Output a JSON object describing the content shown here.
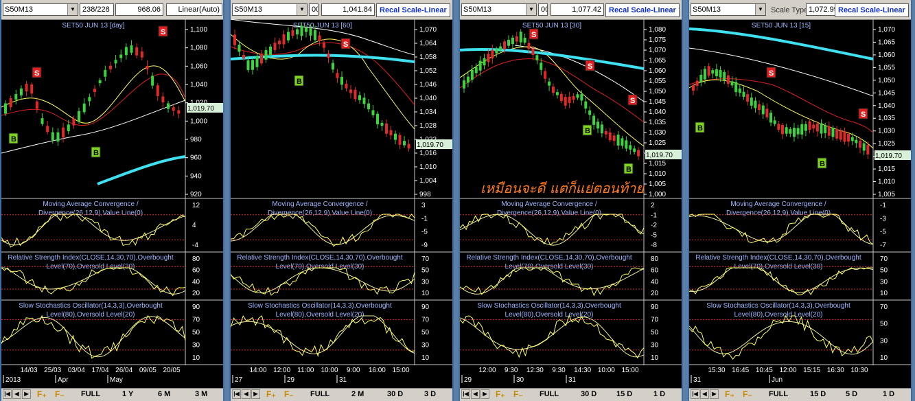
{
  "colors": {
    "candle_up": "#3cd43c",
    "candle_down": "#e02a2a",
    "ma_white": "#ffffff",
    "ma_yellow": "#ffff60",
    "ma_red": "#e02020",
    "ma_cyan": "#3fe0f0",
    "indicator_title": "#9fb8ff",
    "axis_text": "#ffffff",
    "signal_sell": "#e02020",
    "signal_buy": "#7ed321",
    "grid_red": "#d03030"
  },
  "annotation": {
    "text": "เหมือนจะดี แต่ก็แย่ตอนท้าย"
  },
  "panels": [
    {
      "id": "day",
      "symbol": "S50M13",
      "field2": "238/228",
      "field3": "968.06",
      "scale_label": "Linear(Auto)",
      "scale_is_button": false,
      "ghost_label": "",
      "title": "SET50 JUN 13   [day]",
      "price_labels": [
        "1,100",
        "1,080",
        "1,060",
        "1,040",
        "1,020",
        "1,000",
        "980",
        "960",
        "940",
        "920"
      ],
      "price_range": [
        912,
        1112
      ],
      "last_price": "1,019.70",
      "macd_title": [
        "Moving Average Convergence /",
        "Divergence(26,12,9),Value Line(0)"
      ],
      "macd_ticks": [
        "12",
        "4",
        "-4"
      ],
      "rsi_title": [
        "Relative Strength Index(CLOSE,14,30,70),Overbought",
        "Level(70),Oversold Level(30)"
      ],
      "rsi_ticks": [
        "80",
        "60",
        "40",
        "20"
      ],
      "stoch_title": [
        "Slow Stochastics Oscillator(14,3,3),Overbought",
        "Level(80),Oversold Level(20)"
      ],
      "stoch_ticks": [
        "90",
        "70",
        "50",
        "30",
        "10"
      ],
      "dates_top": [
        "14/03",
        "25/03",
        "03/04",
        "17/04",
        "26/04",
        "09/05",
        "20/05"
      ],
      "dates_bottom": [
        "2013",
        "Apr",
        "May"
      ],
      "bottom": {
        "full": "FULL",
        "p1": "1 Y",
        "p2": "6 M",
        "p3": "3 M"
      }
    },
    {
      "id": "60",
      "symbol": "S50M13",
      "field2": "00",
      "field3": "1,041.84",
      "scale_label": "Recal Scale-Linear",
      "scale_is_button": true,
      "ghost_label": "",
      "title": "SET50 JUN 13   [60]",
      "price_labels": [
        "1,070",
        "1,064",
        "1,058",
        "1,052",
        "1,046",
        "1,040",
        "1,034",
        "1,028",
        "1,022",
        "1,016",
        "1,010",
        "1,004",
        "998"
      ],
      "price_range": [
        995,
        1073
      ],
      "last_price": "1,019.70",
      "macd_title": [
        "Moving Average Convergence /",
        "Divergence(26,12,9),Value Line(0)"
      ],
      "macd_ticks": [
        "3",
        "-1",
        "-5",
        "-9"
      ],
      "rsi_title": [
        "Relative Strength Index(CLOSE,14,30,70),Overbought",
        "Level(70),Oversold Level(30)"
      ],
      "rsi_ticks": [
        "70",
        "50",
        "30",
        "10"
      ],
      "stoch_title": [
        "Slow Stochastics Oscillator(14,3,3),Overbought",
        "Level(80),Oversold Level(20)"
      ],
      "stoch_ticks": [
        "90",
        "70",
        "50",
        "30",
        "10"
      ],
      "dates_top": [
        "14:00",
        "12:00",
        "11:00",
        "10:00",
        "9:00",
        "16:00",
        "15:00"
      ],
      "dates_bottom": [
        "27",
        "29",
        "31"
      ],
      "bottom": {
        "full": "FULL",
        "p1": "2 M",
        "p2": "30 D",
        "p3": "3 D"
      }
    },
    {
      "id": "30",
      "symbol": "S50M13",
      "field2": "00",
      "field3": "1,077.42",
      "scale_label": "Recal Scale-Linear",
      "scale_is_button": true,
      "ghost_label": "",
      "title": "SET50 JUN 13   [30]",
      "price_labels": [
        "1,080",
        "1,075",
        "1,070",
        "1,065",
        "1,060",
        "1,055",
        "1,050",
        "1,045",
        "1,040",
        "1,035",
        "1,030",
        "1,025",
        "1,020",
        "1,015",
        "1,010",
        "1,005",
        "1,000"
      ],
      "price_range": [
        998,
        1082
      ],
      "last_price": "1,019.70",
      "macd_title": [
        "Moving Average Convergence /",
        "Divergence(26,12,9),Value Line(0)"
      ],
      "macd_ticks": [
        "2",
        "-1",
        "-2",
        "-5",
        "-8"
      ],
      "rsi_title": [
        "Relative Strength Index(CLOSE,14,30,70),Overbought",
        "Level(70),Oversold Level(30)"
      ],
      "rsi_ticks": [
        "80",
        "60",
        "40",
        "20"
      ],
      "stoch_title": [
        "Slow Stochastics Oscillator(14,3,3),Overbought",
        "Level(80),Oversold Level(20)"
      ],
      "stoch_ticks": [
        "90",
        "70",
        "50",
        "30",
        "10"
      ],
      "dates_top": [
        "12:00",
        "9:30",
        "12:30",
        "9:30",
        "14:30",
        "10:00",
        "15:00"
      ],
      "dates_bottom": [
        "29",
        "30",
        "31"
      ],
      "bottom": {
        "full": "FULL",
        "p1": "30 D",
        "p2": "15 D",
        "p3": "1 D"
      }
    },
    {
      "id": "15",
      "symbol": "S50M13",
      "field2": "",
      "field3": "1,072.99",
      "scale_label": "Recal Scale-Linear",
      "scale_is_button": true,
      "ghost_label": "Scale Type",
      "title": "SET50 JUN 13   [15]",
      "price_labels": [
        "1,070",
        "1,065",
        "1,060",
        "1,055",
        "1,050",
        "1,045",
        "1,040",
        "1,035",
        "1,030",
        "1,025",
        "1,020",
        "1,015",
        "1,010",
        "1,005"
      ],
      "price_range": [
        1002,
        1073
      ],
      "last_price": "1,019.70",
      "macd_title": [
        "Moving Average Convergence /",
        "Divergence(26,12,9),Value Line(0)"
      ],
      "macd_ticks": [
        "-1",
        "-3",
        "-5",
        "-7"
      ],
      "rsi_title": [
        "Relative Strength Index(CLOSE,14,30,70),Overbought",
        "Level(70),Oversold Level(30)"
      ],
      "rsi_ticks": [
        "70",
        "50",
        "30",
        "10"
      ],
      "stoch_title": [
        "Slow Stochastics Oscillator(14,3,3),Overbought",
        "Level(80),Oversold Level(20)"
      ],
      "stoch_ticks": [
        "70",
        "50",
        "30",
        "10"
      ],
      "dates_top": [
        "15:30",
        "16:45",
        "10:45",
        "12:00",
        "15:15",
        "16:30",
        "10:30"
      ],
      "dates_bottom": [
        "31",
        "Jun"
      ],
      "bottom": {
        "full": "FULL",
        "p1": "15 D",
        "p2": "5 D",
        "p3": "1 D"
      }
    }
  ]
}
